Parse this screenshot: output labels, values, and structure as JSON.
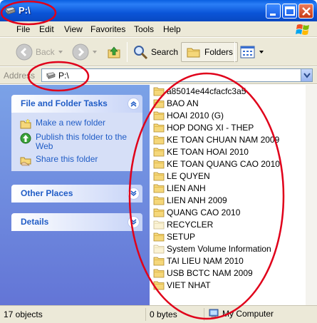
{
  "window": {
    "title": "P:\\"
  },
  "menu": [
    "File",
    "Edit",
    "View",
    "Favorites",
    "Tools",
    "Help"
  ],
  "toolbar": {
    "back_label": "Back",
    "search_label": "Search",
    "folders_label": "Folders"
  },
  "address": {
    "label": "Address",
    "value": "P:\\"
  },
  "taskpane": {
    "file_folder_tasks": {
      "title": "File and Folder Tasks",
      "tasks": [
        "Make a new folder",
        "Publish this folder to the Web",
        "Share this folder"
      ]
    },
    "other_places": {
      "title": "Other Places"
    },
    "details": {
      "title": "Details"
    }
  },
  "files": [
    "a85014e44cfacfc3a5",
    "BAO AN",
    "HOAI 2010 (G)",
    "HOP DONG XI - THEP",
    "KE TOAN CHUAN NAM 2009",
    "KE TOAN HOAI 2010",
    "KE TOAN QUANG CAO 2010",
    "LE QUYEN",
    "LIEN ANH",
    "LIEN ANH 2009",
    "QUANG CAO 2010",
    "RECYCLER",
    "SETUP",
    "System Volume Information",
    "TAI LIEU NAM 2010",
    "USB BCTC NAM 2009",
    "VIET NHAT"
  ],
  "status": {
    "objects": "17 objects",
    "size": "0 bytes",
    "location": "My Computer"
  },
  "colors": {
    "titlebar": "#0b55d8",
    "task_text": "#215dc6",
    "annotation": "#e0001a"
  }
}
